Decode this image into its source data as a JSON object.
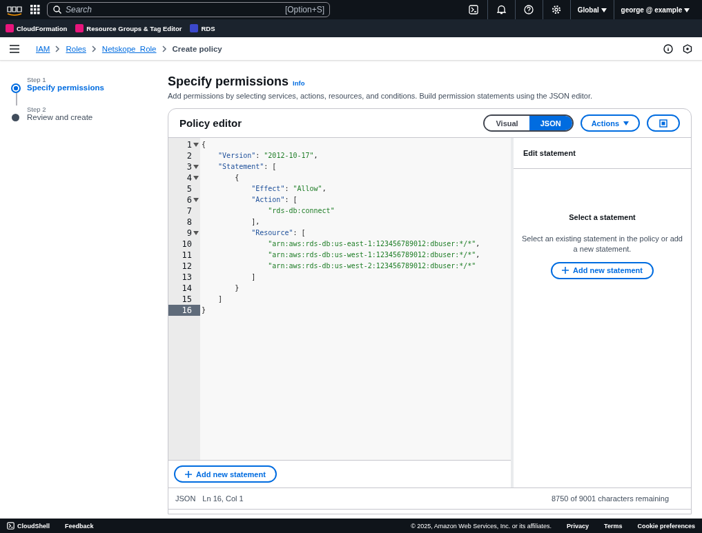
{
  "top_nav": {
    "search": {
      "placeholder": "Search",
      "shortcut": "[Option+S]"
    },
    "region": "Global",
    "account": "george @ example"
  },
  "favorites": [
    {
      "label": "CloudFormation",
      "color": "#e7157b"
    },
    {
      "label": "Resource Groups & Tag Editor",
      "color": "#e7157b"
    },
    {
      "label": "RDS",
      "color": "#3b48cc"
    }
  ],
  "breadcrumbs": [
    {
      "label": "IAM",
      "link": true
    },
    {
      "label": "Roles",
      "link": true
    },
    {
      "label": "Netskope_Role",
      "link": true
    },
    {
      "label": "Create policy",
      "link": false
    }
  ],
  "steps": [
    {
      "step": "Step 1",
      "title": "Specify permissions",
      "selected": true
    },
    {
      "step": "Step 2",
      "title": "Review and create",
      "selected": false
    }
  ],
  "header": {
    "title": "Specify permissions",
    "info": "Info",
    "description": "Add permissions by selecting services, actions, resources, and conditions. Build permission statements using the JSON editor."
  },
  "policy_editor": {
    "title": "Policy editor",
    "modes": [
      {
        "label": "Visual",
        "selected": false
      },
      {
        "label": "JSON",
        "selected": true
      }
    ],
    "actions": "Actions",
    "code_lines": [
      {
        "number": "1",
        "foldable": true,
        "current": false,
        "segments": [
          {
            "kind": "punct",
            "text": "{"
          }
        ]
      },
      {
        "number": "2",
        "foldable": false,
        "current": false,
        "segments": [
          {
            "kind": "key",
            "text": "    \"Version\""
          },
          {
            "kind": "punct",
            "text": ": "
          },
          {
            "kind": "string",
            "text": "\"2012-10-17\""
          },
          {
            "kind": "punct",
            "text": ","
          }
        ]
      },
      {
        "number": "3",
        "foldable": true,
        "current": false,
        "segments": [
          {
            "kind": "key",
            "text": "    \"Statement\""
          },
          {
            "kind": "punct",
            "text": ": ["
          }
        ]
      },
      {
        "number": "4",
        "foldable": true,
        "current": false,
        "segments": [
          {
            "kind": "punct",
            "text": "        {"
          }
        ]
      },
      {
        "number": "5",
        "foldable": false,
        "current": false,
        "segments": [
          {
            "kind": "key",
            "text": "            \"Effect\""
          },
          {
            "kind": "punct",
            "text": ": "
          },
          {
            "kind": "string",
            "text": "\"Allow\""
          },
          {
            "kind": "punct",
            "text": ","
          }
        ]
      },
      {
        "number": "6",
        "foldable": true,
        "current": false,
        "segments": [
          {
            "kind": "key",
            "text": "            \"Action\""
          },
          {
            "kind": "punct",
            "text": ": ["
          }
        ]
      },
      {
        "number": "7",
        "foldable": false,
        "current": false,
        "segments": [
          {
            "kind": "string",
            "text": "                \"rds-db:connect\""
          }
        ]
      },
      {
        "number": "8",
        "foldable": false,
        "current": false,
        "segments": [
          {
            "kind": "punct",
            "text": "            ],"
          }
        ]
      },
      {
        "number": "9",
        "foldable": true,
        "current": false,
        "segments": [
          {
            "kind": "key",
            "text": "            \"Resource\""
          },
          {
            "kind": "punct",
            "text": ": ["
          }
        ]
      },
      {
        "number": "10",
        "foldable": false,
        "current": false,
        "segments": [
          {
            "kind": "string",
            "text": "                \"arn:aws:rds-db:us-east-1:123456789012:dbuser:*/*\""
          },
          {
            "kind": "punct",
            "text": ","
          }
        ]
      },
      {
        "number": "11",
        "foldable": false,
        "current": false,
        "segments": [
          {
            "kind": "string",
            "text": "                \"arn:aws:rds-db:us-west-1:123456789012:dbuser:*/*\""
          },
          {
            "kind": "punct",
            "text": ","
          }
        ]
      },
      {
        "number": "12",
        "foldable": false,
        "current": false,
        "segments": [
          {
            "kind": "string",
            "text": "                \"arn:aws:rds-db:us-west-2:123456789012:dbuser:*/*\""
          }
        ]
      },
      {
        "number": "13",
        "foldable": false,
        "current": false,
        "segments": [
          {
            "kind": "punct",
            "text": "            ]"
          }
        ]
      },
      {
        "number": "14",
        "foldable": false,
        "current": false,
        "segments": [
          {
            "kind": "punct",
            "text": "        }"
          }
        ]
      },
      {
        "number": "15",
        "foldable": false,
        "current": false,
        "segments": [
          {
            "kind": "punct",
            "text": "    ]"
          }
        ]
      },
      {
        "number": "16",
        "foldable": false,
        "current": true,
        "segments": [
          {
            "kind": "punct",
            "text": "}"
          }
        ]
      }
    ],
    "add_statement": "Add new statement",
    "side_panel": {
      "title": "Edit statement",
      "empty_title": "Select a statement",
      "empty_text": "Select an existing statement in the policy or add a new statement.",
      "add_statement": "Add new statement"
    },
    "status": {
      "mode": "JSON",
      "position": "Ln 16, Col 1",
      "remaining": "8750 of 9001 characters remaining"
    }
  },
  "footer": {
    "cloudshell": "CloudShell",
    "feedback": "Feedback",
    "copyright": "© 2025, Amazon Web Services, Inc. or its affiliates.",
    "links": [
      "Privacy",
      "Terms",
      "Cookie preferences"
    ]
  }
}
